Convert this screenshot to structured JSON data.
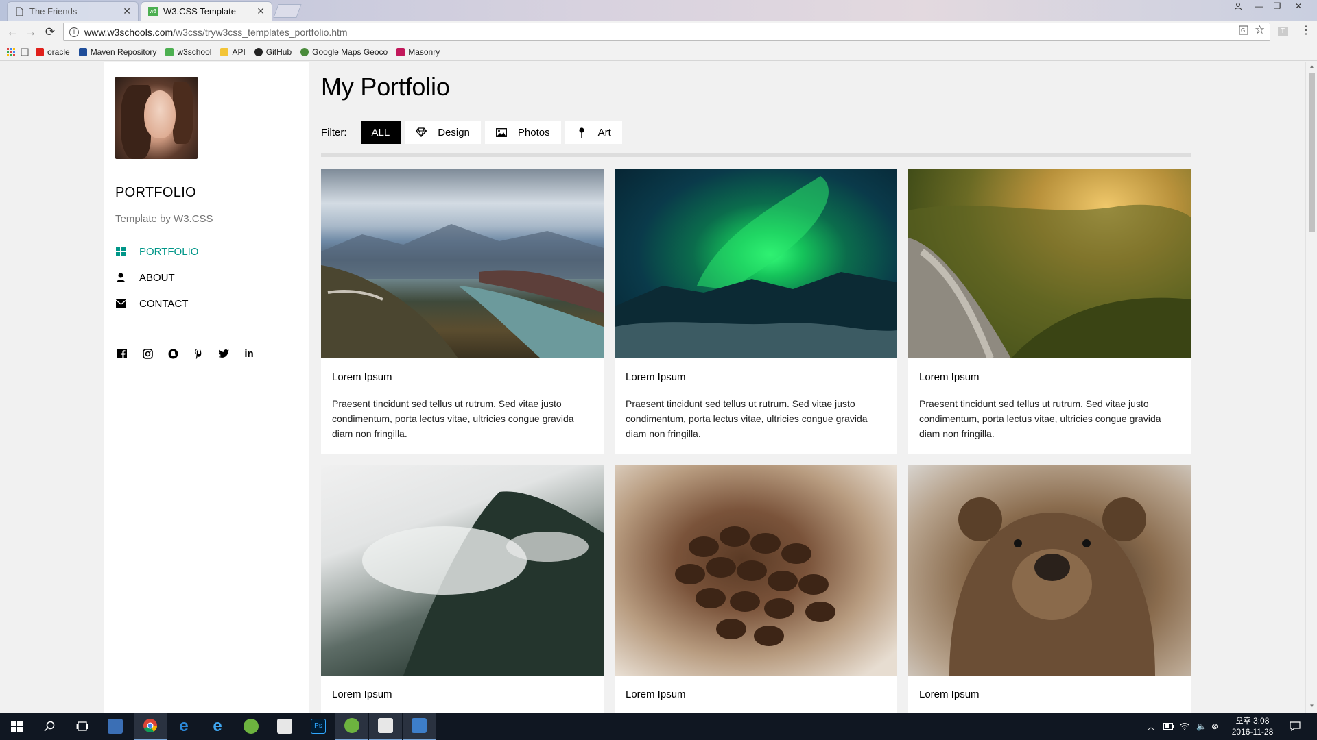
{
  "browser": {
    "tabs": [
      {
        "title": "The Friends",
        "active": false
      },
      {
        "title": "W3.CSS Template",
        "active": true
      }
    ],
    "url_host": "www.w3schools.com",
    "url_path": "/w3css/tryw3css_templates_portfolio.htm",
    "bookmarks": [
      {
        "label": "oracle",
        "icon": "oracle-icon",
        "color": "#e0201b"
      },
      {
        "label": "Maven Repository",
        "icon": "maven-icon",
        "color": "#1f4e9a"
      },
      {
        "label": "w3school",
        "icon": "w3school-icon",
        "color": "#4caf50"
      },
      {
        "label": "API",
        "icon": "folder-icon",
        "color": "#f3c437"
      },
      {
        "label": "GitHub",
        "icon": "github-icon",
        "color": "#222222"
      },
      {
        "label": "Google Maps Geoco",
        "icon": "google-icon",
        "color": "#4a8b3b"
      },
      {
        "label": "Masonry",
        "icon": "masonry-icon",
        "color": "#c2185b"
      }
    ]
  },
  "sidebar": {
    "brand": "PORTFOLIO",
    "tagline": "Template by W3.CSS",
    "nav": [
      {
        "label": "PORTFOLIO",
        "icon": "grid-icon",
        "active": true
      },
      {
        "label": "ABOUT",
        "icon": "user-icon",
        "active": false
      },
      {
        "label": "CONTACT",
        "icon": "envelope-icon",
        "active": false
      }
    ],
    "social": [
      "facebook-icon",
      "instagram-icon",
      "snapchat-icon",
      "pinterest-icon",
      "twitter-icon",
      "linkedin-icon"
    ]
  },
  "main": {
    "title": "My Portfolio",
    "filter_label": "Filter:",
    "filters": [
      {
        "label": "ALL",
        "icon": "",
        "active": true
      },
      {
        "label": "Design",
        "icon": "diamond-icon",
        "active": false
      },
      {
        "label": "Photos",
        "icon": "photo-icon",
        "active": false
      },
      {
        "label": "Art",
        "icon": "map-pin-icon",
        "active": false
      }
    ],
    "cards": [
      {
        "title": "Lorem Ipsum",
        "text": "Praesent tincidunt sed tellus ut rutrum. Sed vitae justo condimentum, porta lectus vitae, ultricies congue gravida diam non fringilla.",
        "image": "mountain-lake-photo"
      },
      {
        "title": "Lorem Ipsum",
        "text": "Praesent tincidunt sed tellus ut rutrum. Sed vitae justo condimentum, porta lectus vitae, ultricies congue gravida diam non fringilla.",
        "image": "aurora-photo"
      },
      {
        "title": "Lorem Ipsum",
        "text": "Praesent tincidunt sed tellus ut rutrum. Sed vitae justo condimentum, porta lectus vitae, ultricies congue gravida diam non fringilla.",
        "image": "forest-valley-photo"
      },
      {
        "title": "Lorem Ipsum",
        "text": "",
        "image": "foggy-mountain-photo"
      },
      {
        "title": "Lorem Ipsum",
        "text": "",
        "image": "coffee-beans-photo"
      },
      {
        "title": "Lorem Ipsum",
        "text": "",
        "image": "bear-photo"
      }
    ]
  },
  "taskbar": {
    "clock_time": "오후 3:08",
    "clock_date": "2016-11-28"
  },
  "colors": {
    "accent": "#009688",
    "page_bg": "#f1f1f1",
    "taskbar_bg": "#101722"
  }
}
